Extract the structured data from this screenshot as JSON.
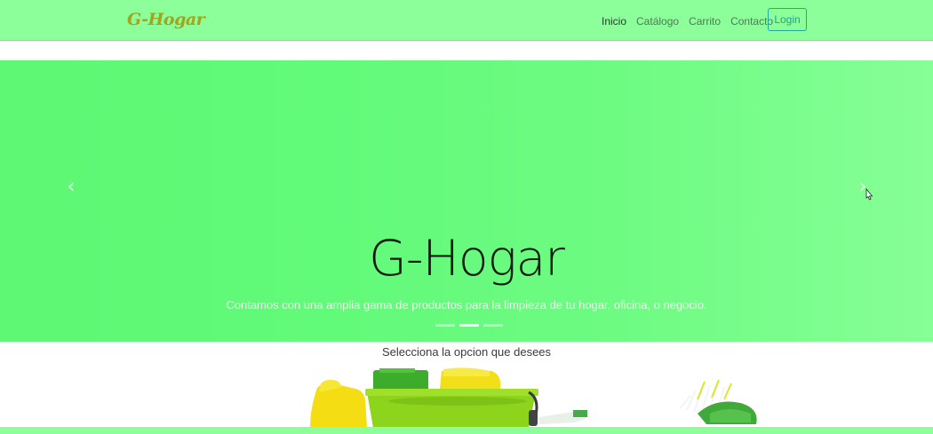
{
  "brand": {
    "name": "G-Hogar"
  },
  "nav": {
    "links": [
      {
        "label": "Inicio",
        "active": true
      },
      {
        "label": "Catálogo"
      },
      {
        "label": "Carrito"
      },
      {
        "label": "Contacto"
      }
    ],
    "login_label": "Login"
  },
  "carousel": {
    "title": "G-Hogar",
    "subtitle": "Contamos con una amplia gama de productos para la limpieza de tu hogar, oficina, o negocio.",
    "prev_icon": "chevron-left-icon",
    "next_icon": "chevron-right-icon",
    "slide_count": 3,
    "active_slide": 2
  },
  "section": {
    "caption": "Selecciona la opcion que desees"
  },
  "colors": {
    "navbar_bg": "#8cff9a",
    "carousel_green": "#62fa79",
    "brand_olive": "#a3a41d",
    "login_teal": "#1f9f98"
  }
}
